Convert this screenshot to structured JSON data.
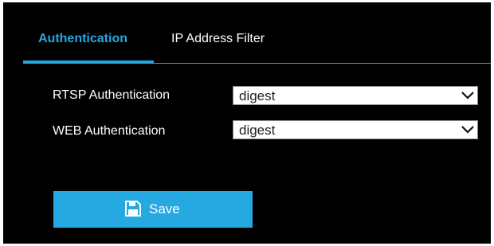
{
  "tabs": [
    {
      "label": "Authentication",
      "active": true
    },
    {
      "label": "IP Address Filter",
      "active": false
    }
  ],
  "form": {
    "rtsp": {
      "label": "RTSP Authentication",
      "value": "digest"
    },
    "web": {
      "label": "WEB Authentication",
      "value": "digest"
    }
  },
  "actions": {
    "save_label": "Save",
    "save_icon": "floppy-disk-icon"
  },
  "colors": {
    "accent": "#24a7e1",
    "background": "#000000",
    "text": "#ffffff"
  }
}
